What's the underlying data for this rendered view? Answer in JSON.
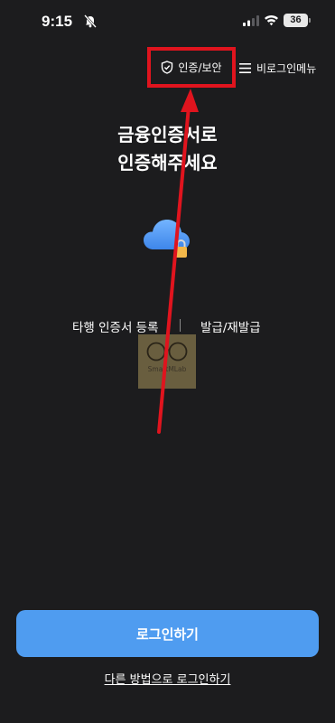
{
  "status_bar": {
    "time": "9:15",
    "battery_level": "36"
  },
  "top_actions": {
    "auth_security_label": "인증/보안",
    "menu_label": "비로그인메뉴"
  },
  "main": {
    "title_line1": "금융인증서로",
    "title_line2": "인증해주세요",
    "register_link": "타행 인증서 등록",
    "issue_link": "발급/재발급"
  },
  "watermark": {
    "text": "SmartMLab"
  },
  "footer": {
    "login_button": "로그인하기",
    "alt_login_link": "다른 방법으로 로그인하기"
  },
  "colors": {
    "background": "#1c1c1e",
    "primary": "#4f9cf0",
    "highlight": "#e0141e"
  },
  "icons": [
    "bell-off-icon",
    "signal-icon",
    "wifi-icon",
    "battery-icon",
    "shield-check-icon",
    "hamburger-menu-icon",
    "cloud-lock-icon"
  ]
}
